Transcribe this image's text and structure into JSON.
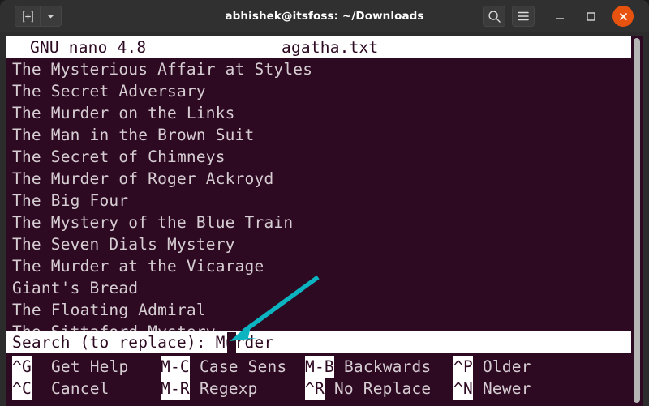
{
  "window": {
    "title": "abhishek@itsfoss: ~/Downloads",
    "titlebar": {
      "new_tab_icon": "new-tab-icon",
      "dropdown_icon": "chevron-down-icon",
      "search_icon": "search-icon",
      "menu_icon": "hamburger-menu-icon",
      "minimize_icon": "minimize-icon",
      "maximize_icon": "maximize-icon",
      "close_icon": "close-icon",
      "close_color": "#e8520f"
    }
  },
  "terminal": {
    "background_color": "#2d0922",
    "foreground_color": "#d6cdd2",
    "nano": {
      "version": "GNU nano 4.8",
      "filename": "agatha.txt",
      "lines": [
        "The Mysterious Affair at Styles",
        "The Secret Adversary",
        "The Murder on the Links",
        "The Man in the Brown Suit",
        "The Secret of Chimneys",
        "The Murder of Roger Ackroyd",
        "The Big Four",
        "The Mystery of the Blue Train",
        "The Seven Dials Mystery",
        "The Murder at the Vicarage",
        "Giant's Bread",
        "The Floating Admiral",
        "The Sittaford Mystery"
      ],
      "prompt": {
        "label": "Search (to replace): ",
        "value": "Murder"
      },
      "shortcuts_row1": [
        {
          "key": "^G",
          "label": " Get Help"
        },
        {
          "key": "M-C",
          "label": " Case Sens"
        },
        {
          "key": "M-B",
          "label": " Backwards"
        },
        {
          "key": "^P",
          "label": " Older"
        }
      ],
      "shortcuts_row2": [
        {
          "key": "^C",
          "label": " Cancel"
        },
        {
          "key": "M-R",
          "label": " Regexp"
        },
        {
          "key": "^R",
          "label": " No Replace"
        },
        {
          "key": "^N",
          "label": " Newer"
        }
      ]
    }
  },
  "annotation": {
    "arrow_color": "#0cb3c0",
    "arrow_name": "pointer-arrow"
  }
}
